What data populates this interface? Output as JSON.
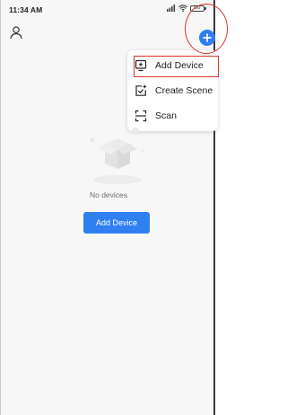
{
  "status_bar": {
    "time": "11:34 AM",
    "battery_level": "100",
    "icons": [
      "signal-icon",
      "wifi-icon",
      "battery-icon"
    ]
  },
  "header": {
    "profile_icon": "person-icon",
    "add_icon": "plus-circle-icon"
  },
  "menu": {
    "items": [
      {
        "label": "Add Device",
        "icon": "add-device-icon"
      },
      {
        "label": "Create Scene",
        "icon": "create-scene-icon"
      },
      {
        "label": "Scan",
        "icon": "scan-icon"
      }
    ]
  },
  "empty_state": {
    "message": "No devices",
    "button_label": "Add Device",
    "illustration": "empty-box-icon"
  },
  "colors": {
    "accent": "#2f7ff0",
    "highlight_annotation": "#d9342b",
    "background": "#f7f7f7"
  }
}
